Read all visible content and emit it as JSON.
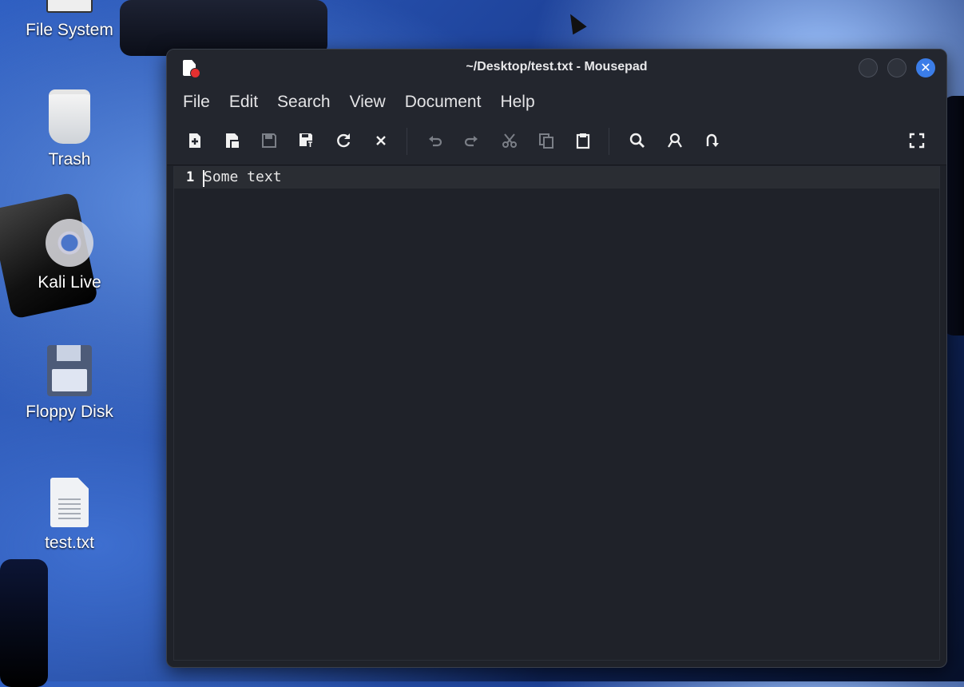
{
  "desktop": {
    "icons": [
      {
        "label": "File System"
      },
      {
        "label": "Trash"
      },
      {
        "label": "Kali Live"
      },
      {
        "label": "Floppy Disk"
      },
      {
        "label": "test.txt"
      }
    ]
  },
  "window": {
    "title": "~/Desktop/test.txt - Mousepad",
    "accent_color": "#3b7de8"
  },
  "menubar": {
    "items": [
      "File",
      "Edit",
      "Search",
      "View",
      "Document",
      "Help"
    ]
  },
  "toolbar": {
    "icons": [
      "new-document-icon",
      "new-window-icon",
      "save-icon",
      "save-as-icon",
      "reload-icon",
      "close-document-icon",
      "undo-icon",
      "redo-icon",
      "cut-icon",
      "copy-icon",
      "paste-icon",
      "find-icon",
      "find-replace-icon",
      "goto-line-icon",
      "fullscreen-icon"
    ]
  },
  "editor": {
    "lines": [
      {
        "number": "1",
        "text": "Some text"
      }
    ]
  }
}
